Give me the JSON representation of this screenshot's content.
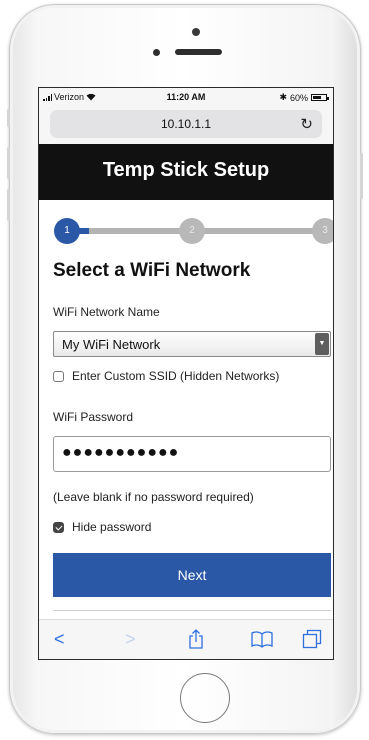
{
  "status_bar": {
    "carrier": "Verizon",
    "time": "11:20 AM",
    "battery": "60%",
    "icons": [
      "signal-icon",
      "wifi-icon",
      "bluetooth-icon",
      "battery-icon"
    ]
  },
  "browser": {
    "url": "10.10.1.1",
    "reload_icon": "reload-icon",
    "toolbar_icons": [
      "back-arrow-icon",
      "forward-arrow-icon",
      "share-icon",
      "bookmarks-icon",
      "tabs-icon"
    ]
  },
  "page": {
    "title": "Temp Stick Setup",
    "steps": [
      "1",
      "2",
      "3"
    ],
    "active_step": 1,
    "heading": "Select a WiFi Network",
    "network_label": "WiFi Network Name",
    "network_value": "My WiFi Network",
    "custom_ssid_label": "Enter Custom SSID (Hidden Networks)",
    "custom_ssid_checked": false,
    "password_label": "WiFi Password",
    "password_value": "●●●●●●●●●●●",
    "password_hint": "(Leave blank if no password required)",
    "hide_password_label": "Hide password",
    "hide_password_checked": true,
    "next_label": "Next"
  },
  "colors": {
    "accent": "#2a57a6",
    "title_bar": "#111111",
    "step_inactive": "#b8b8b8",
    "link_blue": "#2f6fe0"
  }
}
